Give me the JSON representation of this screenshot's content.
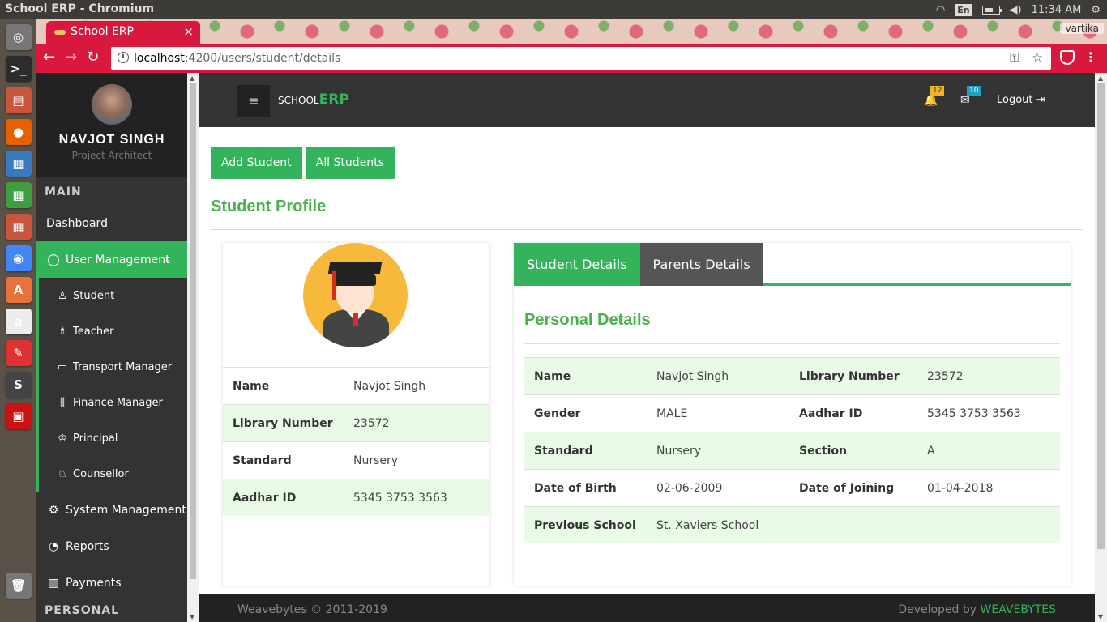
{
  "os": {
    "window_title": "School ERP - Chromium",
    "lang": "En",
    "time": "11:34 AM",
    "battery_fraction": 0.6
  },
  "launcher": [
    {
      "name": "ubuntu-dash-icon",
      "glyph": "◎",
      "color": "#777"
    },
    {
      "name": "terminal-icon",
      "glyph": ">_",
      "color": "#2c2c2c"
    },
    {
      "name": "files-icon",
      "glyph": "▤",
      "color": "#c9563c"
    },
    {
      "name": "firefox-icon",
      "glyph": "●",
      "color": "#e66000"
    },
    {
      "name": "writer-icon",
      "glyph": "▦",
      "color": "#3a7bbf"
    },
    {
      "name": "calc-icon",
      "glyph": "▦",
      "color": "#3f9e3f"
    },
    {
      "name": "impress-icon",
      "glyph": "▦",
      "color": "#c9563c"
    },
    {
      "name": "chromium-icon",
      "glyph": "◉",
      "color": "#4285f4"
    },
    {
      "name": "software-center-icon",
      "glyph": "A",
      "color": "#e8733a"
    },
    {
      "name": "amazon-icon",
      "glyph": "a",
      "color": "#ececec"
    },
    {
      "name": "settings-tools-icon",
      "glyph": "✎",
      "color": "#d33"
    },
    {
      "name": "sublime-icon",
      "glyph": "S",
      "color": "#444"
    },
    {
      "name": "app-red-icon",
      "glyph": "▣",
      "color": "#c11"
    },
    {
      "name": "trash-icon",
      "glyph": "🗑",
      "color": "#777"
    }
  ],
  "browser": {
    "tab_title": "School ERP",
    "tab_close": "×",
    "profile_user": "vartika",
    "url_host": "localhost",
    "url_rest": ":4200/users/student/details"
  },
  "sidebar": {
    "user_name": "NAVJOT SINGH",
    "user_role": "Project Architect",
    "section_main": "MAIN",
    "section_personal": "PERSONAL",
    "dashboard": "Dashboard",
    "user_management": "User Management",
    "sub_items": [
      "Student",
      "Teacher",
      "Transport Manager",
      "Finance Manager",
      "Principal",
      "Counsellor"
    ],
    "system_management": "System Management",
    "reports": "Reports",
    "payments": "Payments"
  },
  "header": {
    "brand_small": "SCHOOL",
    "brand_big": "ERP",
    "notifications": "12",
    "messages": "10",
    "logout": "Logout"
  },
  "actions": {
    "add_student": "Add Student",
    "all_students": "All Students"
  },
  "page_title": "Student Profile",
  "profile_card": {
    "rows": [
      {
        "label": "Name",
        "value": "Navjot Singh"
      },
      {
        "label": "Library Number",
        "value": "23572"
      },
      {
        "label": "Standard",
        "value": "Nursery"
      },
      {
        "label": "Aadhar ID",
        "value": "5345 3753 3563"
      }
    ]
  },
  "details": {
    "tabs": [
      "Student Details",
      "Parents Details"
    ],
    "section_title": "Personal Details",
    "rows": [
      {
        "k1": "Name",
        "v1": "Navjot Singh",
        "k2": "Library Number",
        "v2": "23572"
      },
      {
        "k1": "Gender",
        "v1": "MALE",
        "k2": "Aadhar ID",
        "v2": "5345 3753 3563"
      },
      {
        "k1": "Standard",
        "v1": "Nursery",
        "k2": "Section",
        "v2": "A"
      },
      {
        "k1": "Date of Birth",
        "v1": "02-06-2009",
        "k2": "Date of Joining",
        "v2": "01-04-2018"
      },
      {
        "k1": "Previous School",
        "v1": "St. Xaviers School",
        "k2": "",
        "v2": ""
      }
    ]
  },
  "footer": {
    "copyright": "Weavebytes © 2011-2019",
    "developed_by": "Developed by",
    "company": "WEAVEBYTES"
  },
  "colors": {
    "accent": "#33b35a",
    "browser_red": "#d9183e",
    "sidebar_bg": "#333333"
  }
}
